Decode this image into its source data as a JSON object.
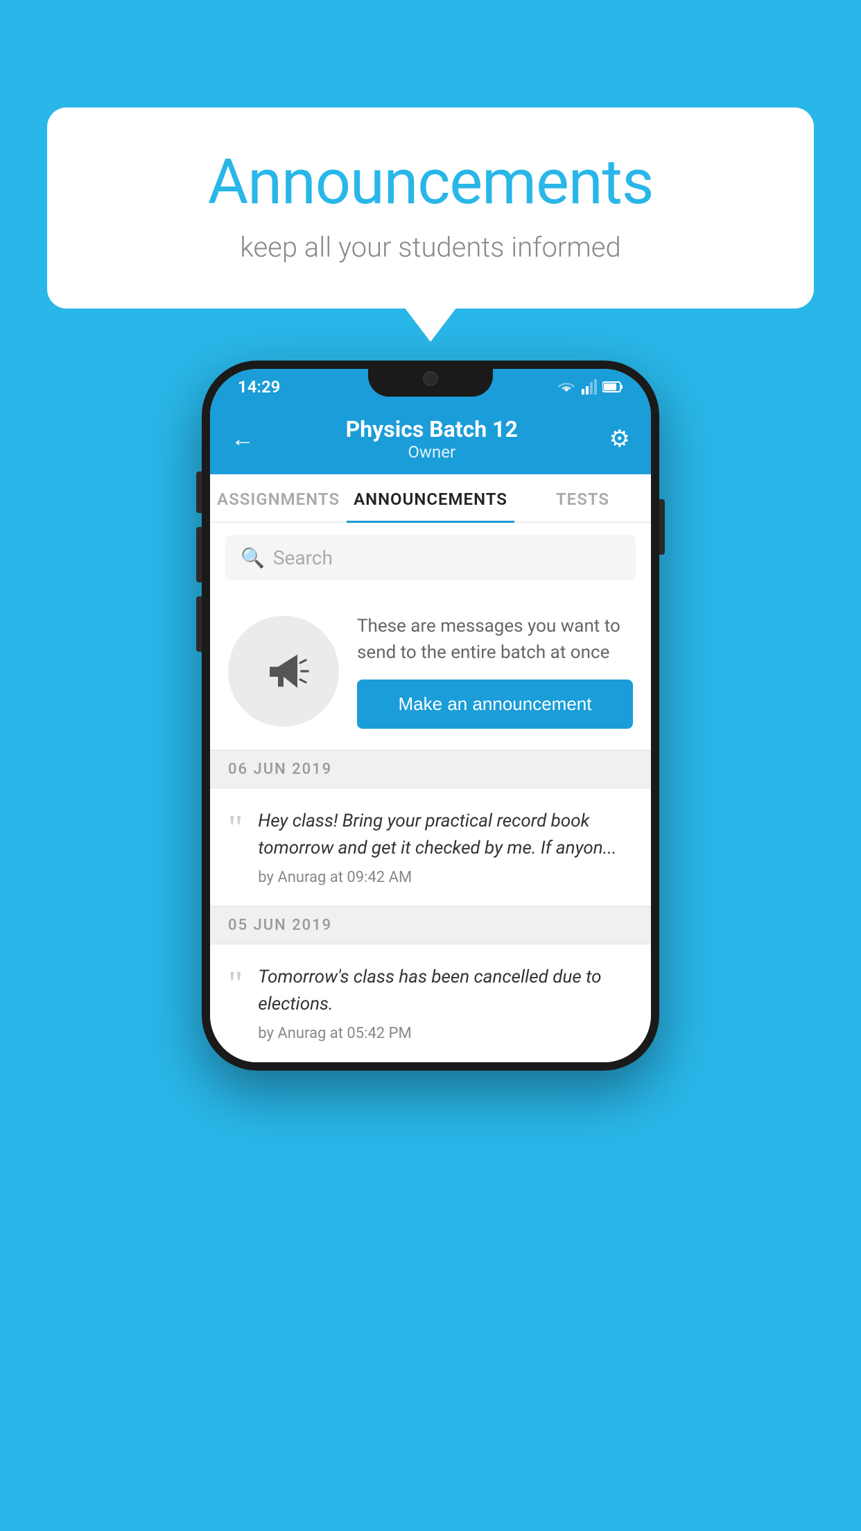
{
  "background": "#29b6e8",
  "speech_bubble": {
    "title": "Announcements",
    "subtitle": "keep all your students informed"
  },
  "phone": {
    "status_bar": {
      "time": "14:29"
    },
    "header": {
      "title": "Physics Batch 12",
      "subtitle": "Owner",
      "back_icon": "←",
      "gear_icon": "⚙"
    },
    "tabs": [
      {
        "label": "ASSIGNMENTS",
        "active": false
      },
      {
        "label": "ANNOUNCEMENTS",
        "active": true
      },
      {
        "label": "TESTS",
        "active": false
      }
    ],
    "search": {
      "placeholder": "Search"
    },
    "cta": {
      "description": "These are messages you want to send to the entire batch at once",
      "button_label": "Make an announcement"
    },
    "announcements": [
      {
        "date": "06  JUN  2019",
        "text": "Hey class! Bring your practical record book tomorrow and get it checked by me. If anyon...",
        "meta": "by Anurag at 09:42 AM"
      },
      {
        "date": "05  JUN  2019",
        "text": "Tomorrow's class has been cancelled due to elections.",
        "meta": "by Anurag at 05:42 PM"
      }
    ]
  }
}
